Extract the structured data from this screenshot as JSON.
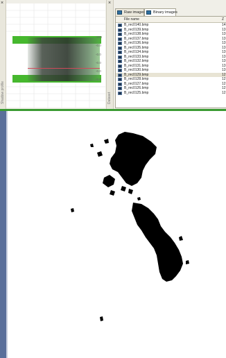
{
  "left_panel": {
    "close_glyph": "×",
    "vertical_label": "Shadow profile",
    "scale_ticks": [
      "-200",
      "-0.0",
      "-0.0",
      "-0.0",
      "-0.0",
      "-0.0"
    ]
  },
  "right_panel": {
    "close_glyph": "×",
    "vertical_label": "Dataset",
    "tabs": [
      {
        "label": "Raw images",
        "icon": "image-icon",
        "active": false
      },
      {
        "label": "Binary images",
        "icon": "image-icon",
        "active": true
      }
    ],
    "columns": {
      "name": "File name",
      "size": "Z"
    },
    "files": [
      {
        "name": "B_rec0140.bmp",
        "size": "14"
      },
      {
        "name": "B_rec0139.bmp",
        "size": "13"
      },
      {
        "name": "B_rec0138.bmp",
        "size": "13"
      },
      {
        "name": "B_rec0137.bmp",
        "size": "13"
      },
      {
        "name": "B_rec0136.bmp",
        "size": "13"
      },
      {
        "name": "B_rec0135.bmp",
        "size": "13"
      },
      {
        "name": "B_rec0134.bmp",
        "size": "13"
      },
      {
        "name": "B_rec0133.bmp",
        "size": "13"
      },
      {
        "name": "B_rec0132.bmp",
        "size": "13"
      },
      {
        "name": "B_rec0131.bmp",
        "size": "13"
      },
      {
        "name": "B_rec0130.bmp",
        "size": "13"
      },
      {
        "name": "B_rec0129.bmp",
        "size": "12"
      },
      {
        "name": "B_rec0128.bmp",
        "size": "12"
      },
      {
        "name": "B_rec0127.bmp",
        "size": "12"
      },
      {
        "name": "B_rec0126.bmp",
        "size": "12"
      },
      {
        "name": "B_rec0125.bmp",
        "size": "12"
      }
    ],
    "selected_file": "B_rec0129.bmp"
  },
  "colors": {
    "accent_green": "#46b82e",
    "separator_green": "#3a9a32",
    "panel_bg": "#f0efe8",
    "viewer_edge": "#5a6f9a",
    "binary_ink": "#000000"
  }
}
